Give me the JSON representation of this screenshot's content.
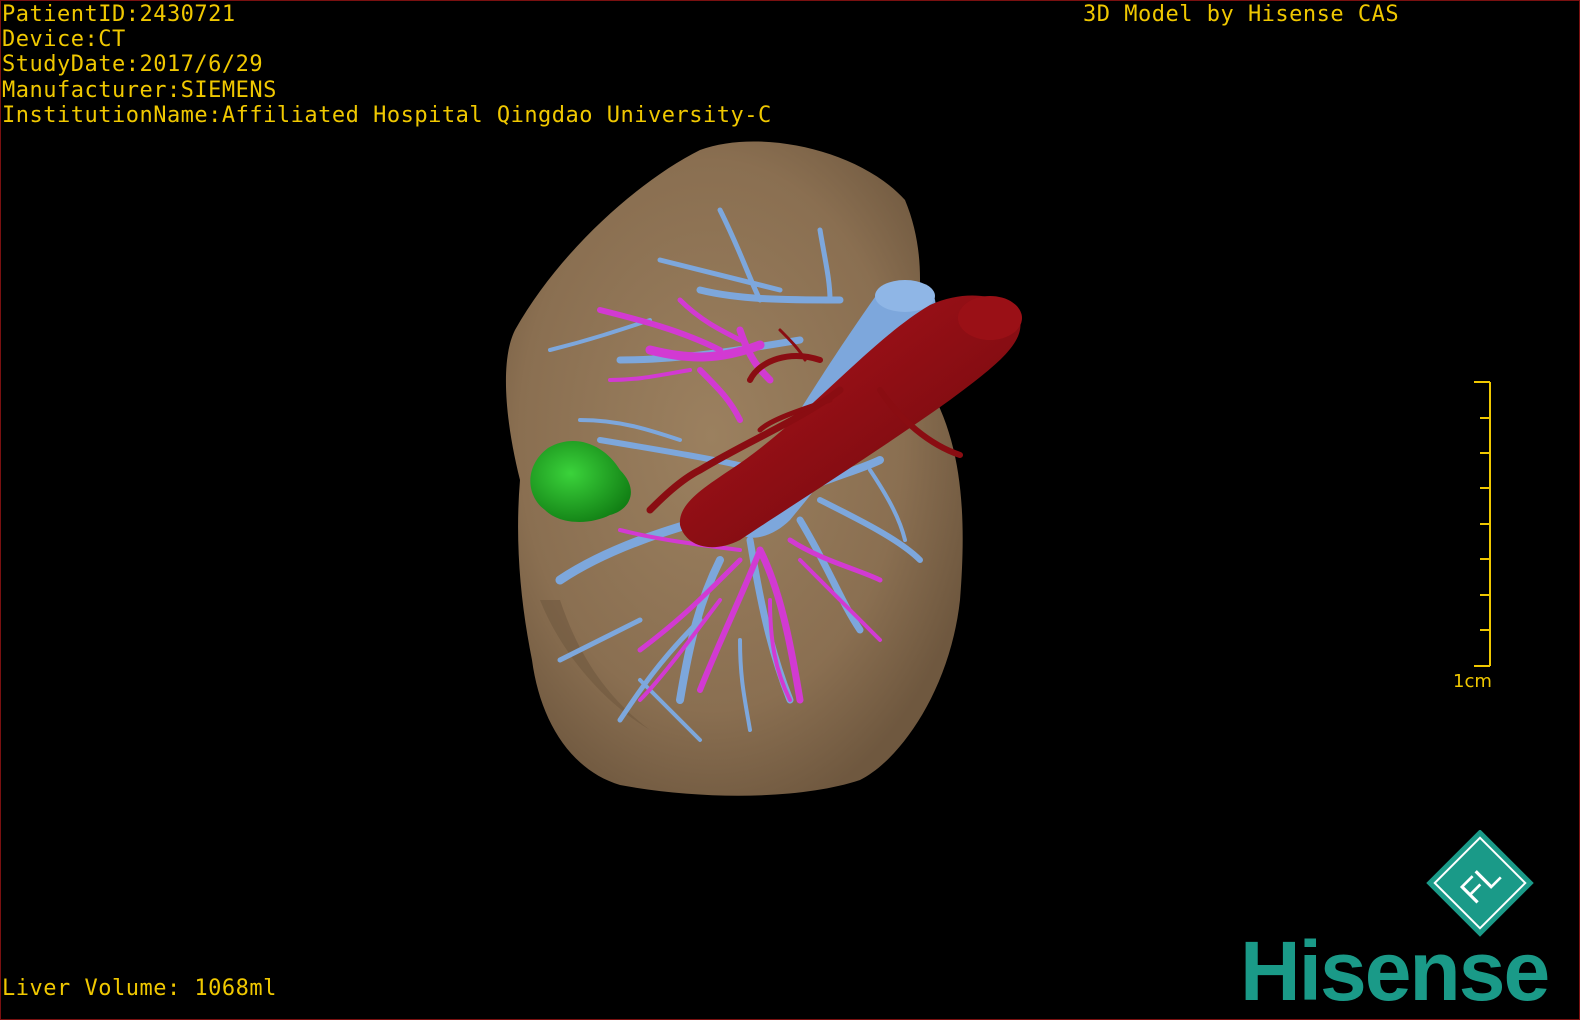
{
  "viewer": {
    "info_lines": {
      "patient_id": "PatientID:2430721",
      "device": "Device:CT",
      "study_date": "StudyDate:2017/6/29",
      "manufacturer": "Manufacturer:SIEMENS",
      "institution": "InstitutionName:Affiliated Hospital Qingdao University-C"
    },
    "model_credit": "3D Model by Hisense CAS",
    "liver_volume": "Liver Volume: 1068ml",
    "scale_label": "1cm"
  },
  "logo": {
    "wordmark": "Hisense",
    "badge_letters": "FL"
  },
  "colors": {
    "text": "#f0c800",
    "background": "#000000",
    "liver": "#8a7052",
    "portal_vein": "#7da7dc",
    "hepatic_vein": "#d23ad2",
    "vena_cava": "#8a0d12",
    "tumor": "#22a022",
    "brand": "#1a9a88"
  }
}
